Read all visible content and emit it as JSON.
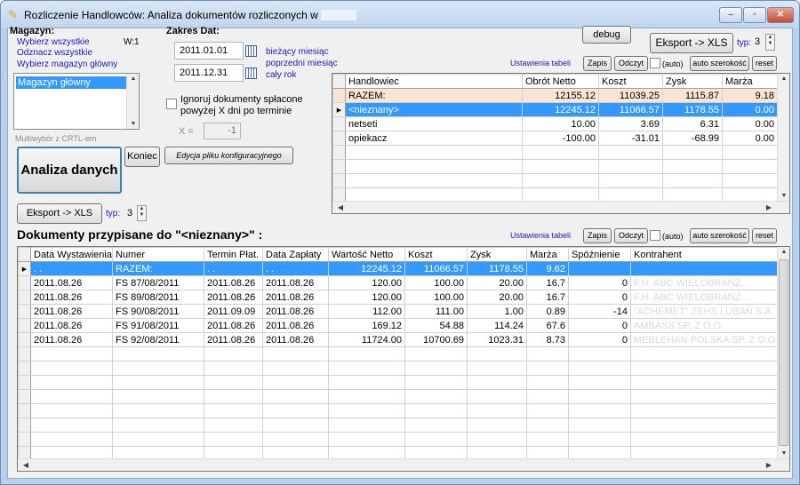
{
  "window": {
    "title": "Rozliczenie Handlowców: Analiza dokumentów rozliczonych w okresie",
    "controls": [
      "‒",
      "▫",
      "✕"
    ]
  },
  "left": {
    "magazyn_label": "Magazyn:",
    "select_all": "Wybierz wszystkie",
    "w_label": "W:1",
    "deselect_all": "Odznacz wszystkie",
    "select_main": "Wybierz magazyn główny",
    "list_items": [
      "Magazyn główny"
    ],
    "multiselect_hint": "Multiwybór z CRTL-em",
    "analyze_button": "Analiza danych",
    "end_button": "Koniec",
    "export_button": "Eksport -> XLS",
    "typ_label": "typ:",
    "typ_value": "3"
  },
  "dates": {
    "range_label": "Zakres Dat:",
    "date_from": "2011.01.01",
    "date_to": "2011.12.31",
    "current_month": "bieżący miesiąc",
    "previous_month": "poprzedni miesiąc",
    "whole_year": "cały rok",
    "ignore_label": "Ignoruj dokumenty spłacone powyżej X dni po terminie",
    "x_label": "X =",
    "x_value": "-1",
    "edit_config_button": "Edycja pliku konfiguracyjnego"
  },
  "top_right": {
    "debug_button": "debug",
    "export_button": "Eksport -> XLS",
    "typ_label": "typ:",
    "typ_value": "3",
    "table_settings": "Ustawienia tabeli",
    "save": "Zapis",
    "read": "Odczyt",
    "auto": "(auto)",
    "auto_width": "auto szerokość",
    "reset": "reset"
  },
  "sales_table": {
    "columns": [
      "Handlowiec",
      "Obrót Netto",
      "Koszt",
      "Zysk",
      "Marża"
    ],
    "rows": [
      {
        "name": "RAZEM:",
        "net": "12155.12",
        "cost": "11039.25",
        "profit": "1115.87",
        "margin": "9.18"
      },
      {
        "name": "<nieznany>",
        "net": "12245.12",
        "cost": "11066.57",
        "profit": "1178.55",
        "margin": "0.00"
      },
      {
        "name": "netseti",
        "net": "10.00",
        "cost": "3.69",
        "profit": "6.31",
        "margin": "0.00"
      },
      {
        "name": "opiekacz",
        "net": "-100.00",
        "cost": "-31.01",
        "profit": "-68.99",
        "margin": "0.00"
      }
    ]
  },
  "docs": {
    "heading": "Dokumenty przypisane do \"<nieznany>\" :",
    "table_settings": "Ustawienia tabeli",
    "save": "Zapis",
    "read": "Odczyt",
    "auto": "(auto)",
    "auto_width": "auto szerokość",
    "reset": "reset",
    "columns": [
      "Data Wystawienia",
      "Numer",
      "Termin Płat.",
      "Data Zapłaty",
      "Wartość Netto",
      "Koszt",
      "Zysk",
      "Marża",
      "Spóźnienie",
      "Kontrahent"
    ],
    "rows": [
      {
        "date": ". .",
        "number": "RAZEM:",
        "due": ". .",
        "paid": ". .",
        "net": "12245.12",
        "cost": "11066.57",
        "profit": "1178.55",
        "margin": "9.62",
        "late": "",
        "client": ""
      },
      {
        "date": "2011.08.26",
        "number": "FS 87/08/2011",
        "due": "2011.08.26",
        "paid": "2011.08.26",
        "net": "120.00",
        "cost": "100.00",
        "profit": "20.00",
        "margin": "16.7",
        "late": "0",
        "client": "F.H. ABC WIELOBRANŻ..."
      },
      {
        "date": "2011.08.26",
        "number": "FS 89/08/2011",
        "due": "2011.08.26",
        "paid": "2011.08.26",
        "net": "120.00",
        "cost": "100.00",
        "profit": "20.00",
        "margin": "16.7",
        "late": "0",
        "client": "F.H. ABC WIELOBRANŻ..."
      },
      {
        "date": "2011.08.26",
        "number": "FS 90/08/2011",
        "due": "2011.09.09",
        "paid": "2011.08.26",
        "net": "112.00",
        "cost": "111.00",
        "profit": "1.00",
        "margin": "0.89",
        "late": "-14",
        "client": "\"ACHEMET\" ZEHS LUBAŃ S.A."
      },
      {
        "date": "2011.08.26",
        "number": "FS 91/08/2011",
        "due": "2011.08.26",
        "paid": "2011.08.26",
        "net": "169.12",
        "cost": "54.88",
        "profit": "114.24",
        "margin": "67.6",
        "late": "0",
        "client": "AMBASS SP. Z O.O."
      },
      {
        "date": "2011.08.26",
        "number": "FS 92/08/2011",
        "due": "2011.08.26",
        "paid": "2011.08.26",
        "net": "11724.00",
        "cost": "10700.69",
        "profit": "1023.31",
        "margin": "8.73",
        "late": "0",
        "client": "MEBLEHAN POLSKA SP. Z O.O."
      }
    ]
  }
}
